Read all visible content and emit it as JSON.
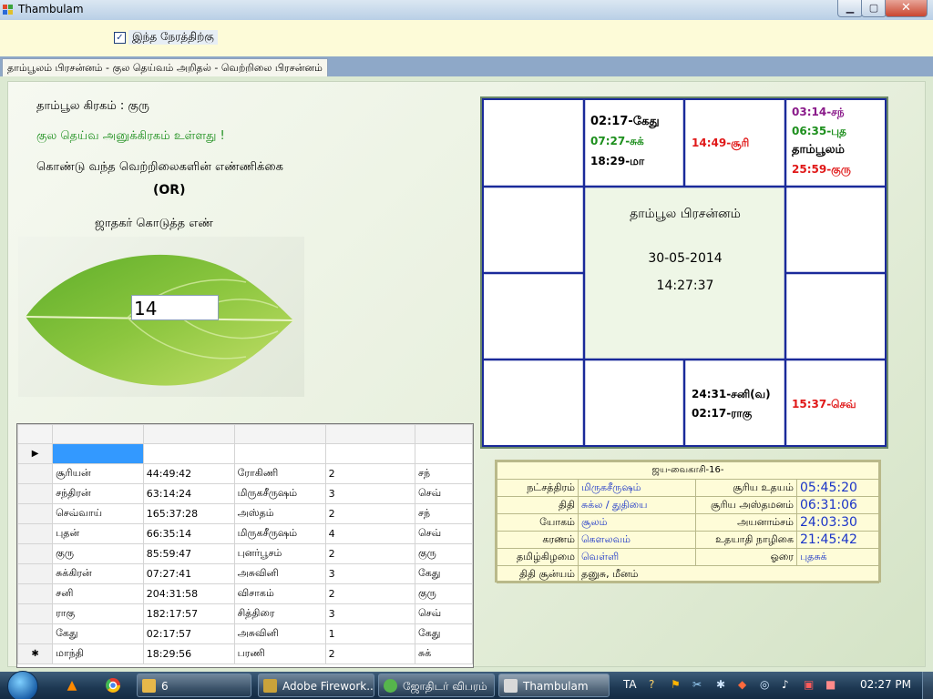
{
  "window": {
    "title": "Thambulam",
    "minimize": "▁",
    "maximize": "▢",
    "close": "✕"
  },
  "checkbox": {
    "label": "இந்த நேரத்திற்கு",
    "checked": true,
    "mark": "✓"
  },
  "tab": {
    "label": "தாம்பூலம் பிரசன்னம் - குல தெய்வம் அறிதல் - வெற்றிலை பிரசன்னம்"
  },
  "left": {
    "planet_line": "தாம்பூல கிரகம் : குரு",
    "blessing": "குல தெய்வ அனுக்கிரகம் உள்ளது !",
    "leaves_count": "கொண்டு வந்த வெற்றிலைகளின் எண்ணிக்கை",
    "or": "(OR)",
    "given_number": "ஜாதகர் கொடுத்த எண்",
    "input_value": "14"
  },
  "grid": {
    "rows": [
      [
        "சூரியன்",
        "44:49:42",
        "ரோகிணி",
        "2",
        "சந்"
      ],
      [
        "சந்திரன்",
        "63:14:24",
        "மிருகசீருஷம்",
        "3",
        "செவ்"
      ],
      [
        "செவ்வாய்",
        "165:37:28",
        "அஸ்தம்",
        "2",
        "சந்"
      ],
      [
        "புதன்",
        "66:35:14",
        "மிருகசீருஷம்",
        "4",
        "செவ்"
      ],
      [
        "குரு",
        "85:59:47",
        "புனர்பூசம்",
        "2",
        "குரு"
      ],
      [
        "சுக்கிரன்",
        "07:27:41",
        "அசுவினி",
        "3",
        "கேது"
      ],
      [
        "சனி",
        "204:31:58",
        "விசாகம்",
        "2",
        "குரு"
      ],
      [
        "ராகு",
        "182:17:57",
        "சித்திரை",
        "3",
        "செவ்"
      ],
      [
        "கேது",
        "02:17:57",
        "அசுவினி",
        "1",
        "கேது"
      ],
      [
        "மாந்தி",
        "18:29:56",
        "பரணி",
        "2",
        "சுக்"
      ]
    ],
    "current_row_marker": "▶",
    "new_row_marker": "✱"
  },
  "chart": {
    "title": "தாம்பூல பிரசன்னம்",
    "date": "30-05-2014",
    "time": "14:27:37",
    "cells": {
      "taurus": [
        {
          "text": "02:17-கேது",
          "color": "#000000"
        },
        {
          "text": "07:27-சுக்",
          "color": "#1d8f1d"
        },
        {
          "text": "18:29-மா",
          "color": "#000000"
        }
      ],
      "gemini": [
        {
          "text": "14:49-சூரி",
          "color": "#e01818"
        }
      ],
      "cancer": [
        {
          "text": "03:14-சந்",
          "color": "#8a1a8a"
        },
        {
          "text": "06:35-புத",
          "color": "#1d8f1d"
        },
        {
          "text": "தாம்பூலம்",
          "color": "#000000"
        },
        {
          "text": "25:59-குரு",
          "color": "#e01818"
        }
      ],
      "libra": [
        {
          "text": "24:31-சனி(வ)",
          "color": "#000000"
        },
        {
          "text": "02:17-ராகு",
          "color": "#000000"
        }
      ],
      "virgo": [
        {
          "text": "15:37-செவ்",
          "color": "#e01818"
        }
      ]
    }
  },
  "panchang": {
    "header": "ஜய-வைகாசி-16-",
    "rows": [
      {
        "l1": "நட்சத்திரம்",
        "v1": "மிருகசீருஷம்",
        "l2": "சூரிய உதயம்",
        "v2": "05:45:20"
      },
      {
        "l1": "திதி",
        "v1": "சுக்ல / துதியை",
        "l2": "சூரிய அஸ்தமனம்",
        "v2": "06:31:06"
      },
      {
        "l1": "யோகம்",
        "v1": "சூலம்",
        "l2": "அயனாம்சம்",
        "v2": "24:03:30"
      },
      {
        "l1": "கரணம்",
        "v1": "கௌலவம்",
        "l2": "உதயாதி நாழிகை",
        "v2": "21:45:42"
      },
      {
        "l1": "தமிழ்கிழமை",
        "v1": "வெள்ளி",
        "l2": "ஓரை",
        "v2": "புதசுக்"
      },
      {
        "l1": "திதி சூன்யம்",
        "v1": "தனுசு, மீனம்",
        "l2": "",
        "v2": ""
      }
    ]
  },
  "taskbar": {
    "buttons": [
      {
        "label": "6",
        "color": "#e8b84a"
      },
      {
        "label": "Adobe Firework...",
        "color": "#c9a23a"
      },
      {
        "label": "ஜோதிடர் விபரம்",
        "color": "#56b54c"
      },
      {
        "label": "Thambulam",
        "color": "#d9d9d9"
      }
    ],
    "language": "TA",
    "clock": "02:27 PM"
  }
}
